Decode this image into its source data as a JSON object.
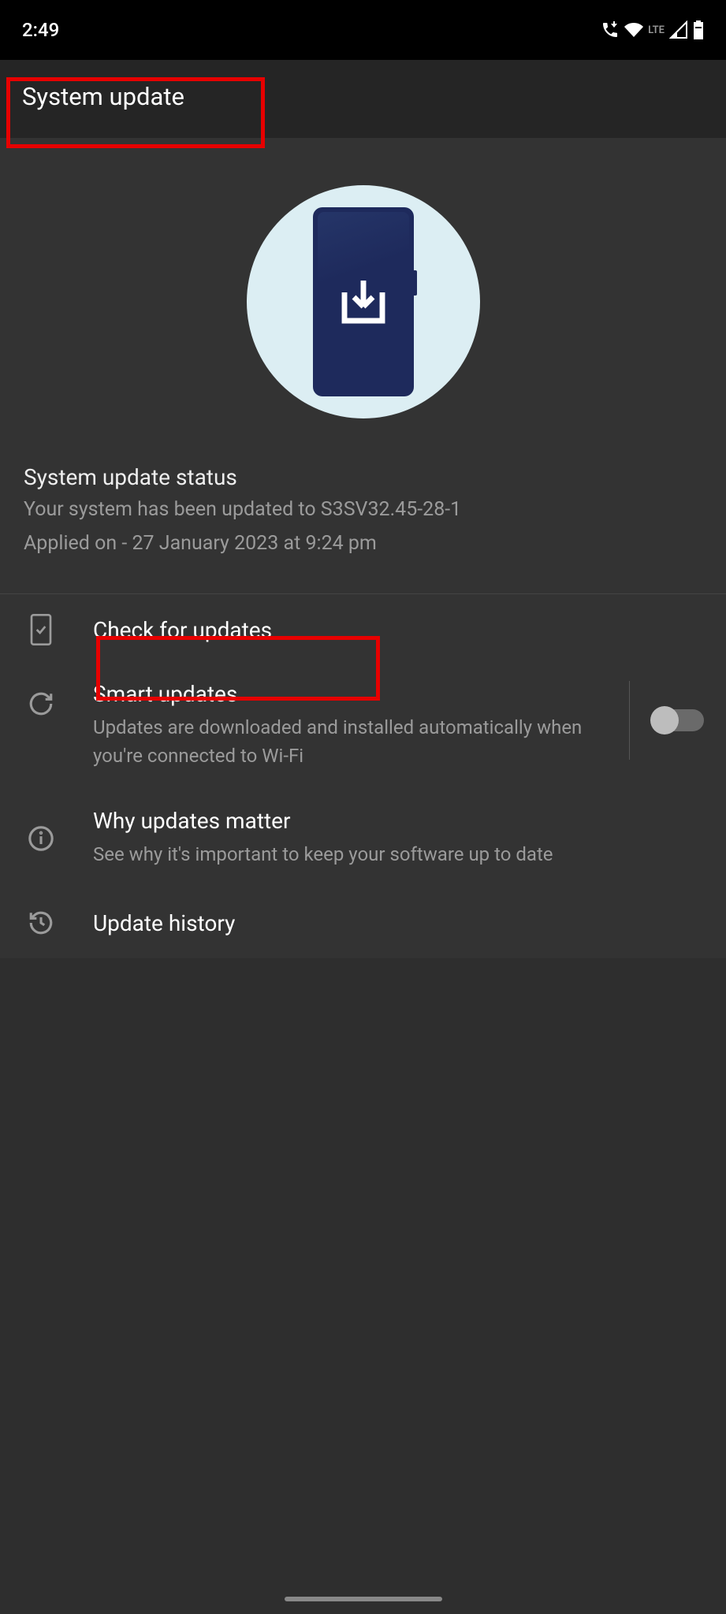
{
  "status_bar": {
    "time": "2:49",
    "network_label": "LTE"
  },
  "header": {
    "title": "System update"
  },
  "hero": {
    "status_title": "System update status",
    "status_body": "Your system has been updated to S3SV32.45-28-1",
    "applied": "Applied on - 27 January 2023 at 9:24 pm"
  },
  "options": {
    "check": {
      "title": "Check for updates"
    },
    "smart": {
      "title": "Smart updates",
      "sub": "Updates are downloaded and installed automatically when you're connected to Wi-Fi",
      "enabled": false
    },
    "why": {
      "title": "Why updates matter",
      "sub": "See why it's important to keep your software up to date"
    },
    "history": {
      "title": "Update history"
    }
  }
}
